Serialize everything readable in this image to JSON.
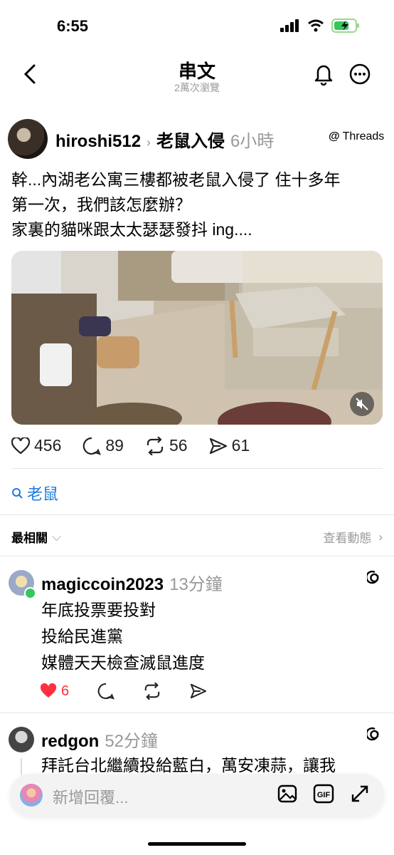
{
  "status": {
    "time": "6:55"
  },
  "nav": {
    "title": "串文",
    "views": "2萬次瀏覽"
  },
  "post": {
    "username": "hiroshi512",
    "topic": "老鼠入侵",
    "time": "6小時",
    "platform_badge": "Threads",
    "lines": [
      "幹...內湖老公寓三樓都被老鼠入侵了 住十多年",
      "第一次，我們該怎麼辦？",
      "家裏的貓咪跟太太瑟瑟發抖 ing...."
    ],
    "likes": "456",
    "comments": "89",
    "reposts": "56",
    "shares": "61",
    "topic_tag": "老鼠"
  },
  "sort": {
    "label": "最相關",
    "activity_link": "查看動態"
  },
  "comments": [
    {
      "username": "magiccoin2023",
      "time": "13分鐘",
      "lines": [
        "年底投票要投對",
        "投給民進黨",
        "媒體天天檢查滅鼠進度"
      ],
      "likes": "6"
    },
    {
      "username": "redgon",
      "time": "52分鐘",
      "lines": [
        "拜託台北繼續投給藍白，萬安凍蒜，讓我"
      ]
    }
  ],
  "reply": {
    "placeholder": "新增回覆..."
  },
  "colors": {
    "accent": "#1a7ae0",
    "like_red": "#ff3040",
    "muted": "#999999"
  }
}
